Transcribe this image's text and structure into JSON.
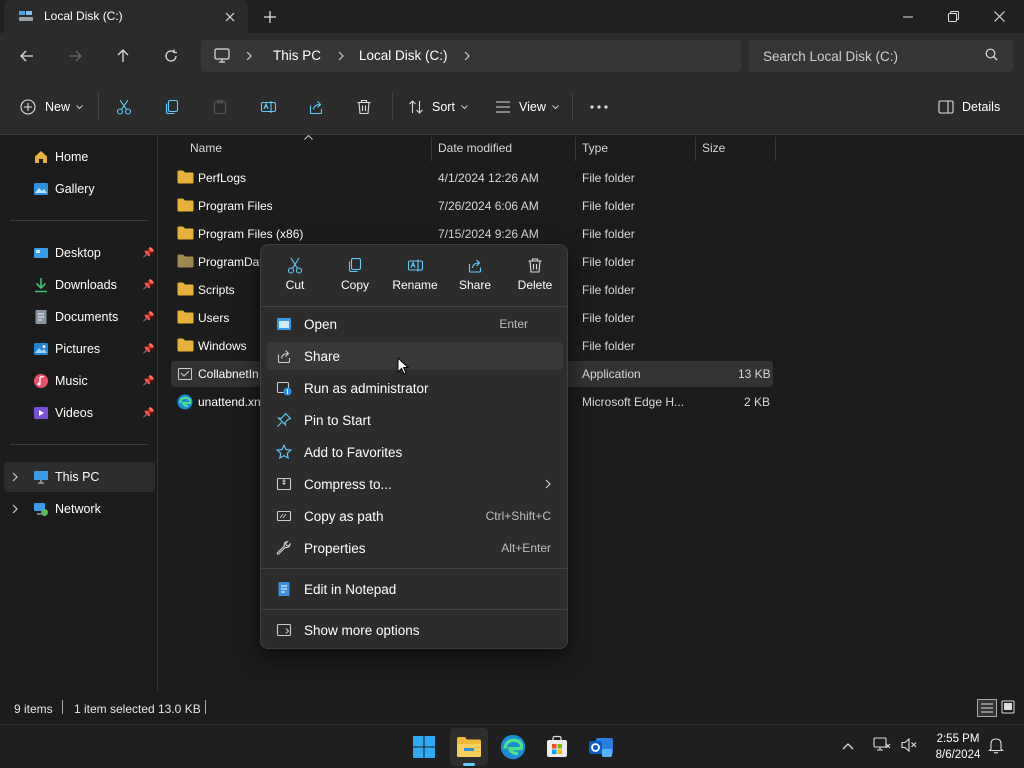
{
  "window": {
    "tab_title": "Local Disk (C:)",
    "colors": {
      "accent": "#60cdff",
      "folder": "#e8b23a",
      "background": "#1c1c1c"
    }
  },
  "address": {
    "breadcrumbs": [
      "This PC",
      "Local Disk (C:)"
    ],
    "search_placeholder": "Search Local Disk (C:)"
  },
  "commands": {
    "new_label": "New",
    "sort_label": "Sort",
    "view_label": "View",
    "details_label": "Details"
  },
  "sidebar": {
    "items": [
      {
        "label": "Home",
        "icon": "home-icon"
      },
      {
        "label": "Gallery",
        "icon": "gallery-icon"
      },
      {
        "label": "Desktop",
        "icon": "desktop-icon",
        "pinned": true
      },
      {
        "label": "Downloads",
        "icon": "download-icon",
        "pinned": true
      },
      {
        "label": "Documents",
        "icon": "documents-icon",
        "pinned": true
      },
      {
        "label": "Pictures",
        "icon": "pictures-icon",
        "pinned": true
      },
      {
        "label": "Music",
        "icon": "music-icon",
        "pinned": true
      },
      {
        "label": "Videos",
        "icon": "videos-icon",
        "pinned": true
      },
      {
        "label": "This PC",
        "icon": "pc-icon",
        "selected": true
      },
      {
        "label": "Network",
        "icon": "network-icon"
      }
    ]
  },
  "columns": {
    "name": "Name",
    "date": "Date modified",
    "type": "Type",
    "size": "Size"
  },
  "files": [
    {
      "name": "PerfLogs",
      "date": "4/1/2024 12:26 AM",
      "type": "File folder",
      "size": ""
    },
    {
      "name": "Program Files",
      "date": "7/26/2024 6:06 AM",
      "type": "File folder",
      "size": ""
    },
    {
      "name": "Program Files (x86)",
      "date": "7/15/2024 9:26 AM",
      "type": "File folder",
      "size": ""
    },
    {
      "name": "ProgramDat",
      "date": "",
      "type": "File folder",
      "size": ""
    },
    {
      "name": "Scripts",
      "date": "",
      "type": "File folder",
      "size": ""
    },
    {
      "name": "Users",
      "date": "",
      "type": "File folder",
      "size": ""
    },
    {
      "name": "Windows",
      "date": "",
      "type": "File folder",
      "size": ""
    },
    {
      "name": "CollabnetIn",
      "date": "",
      "type": "Application",
      "size": "13 KB"
    },
    {
      "name": "unattend.xn",
      "date": "",
      "type": "Microsoft Edge H...",
      "size": "2 KB"
    }
  ],
  "context_menu": {
    "quick_actions": [
      "Cut",
      "Copy",
      "Rename",
      "Share",
      "Delete"
    ],
    "items": [
      {
        "label": "Open",
        "shortcut": "Enter"
      },
      {
        "label": "Share",
        "shortcut": ""
      },
      {
        "label": "Run as administrator",
        "shortcut": ""
      },
      {
        "label": "Pin to Start",
        "shortcut": ""
      },
      {
        "label": "Add to Favorites",
        "shortcut": ""
      },
      {
        "label": "Compress to...",
        "shortcut": ""
      },
      {
        "label": "Copy as path",
        "shortcut": "Ctrl+Shift+C"
      },
      {
        "label": "Properties",
        "shortcut": "Alt+Enter"
      },
      {
        "label": "Edit in Notepad",
        "shortcut": ""
      },
      {
        "label": "Show more options",
        "shortcut": ""
      }
    ]
  },
  "status": {
    "items_count": "9 items",
    "selection": "1 item selected",
    "selection_size": "13.0 KB"
  },
  "taskbar": {
    "time": "2:55 PM",
    "date": "8/6/2024"
  }
}
